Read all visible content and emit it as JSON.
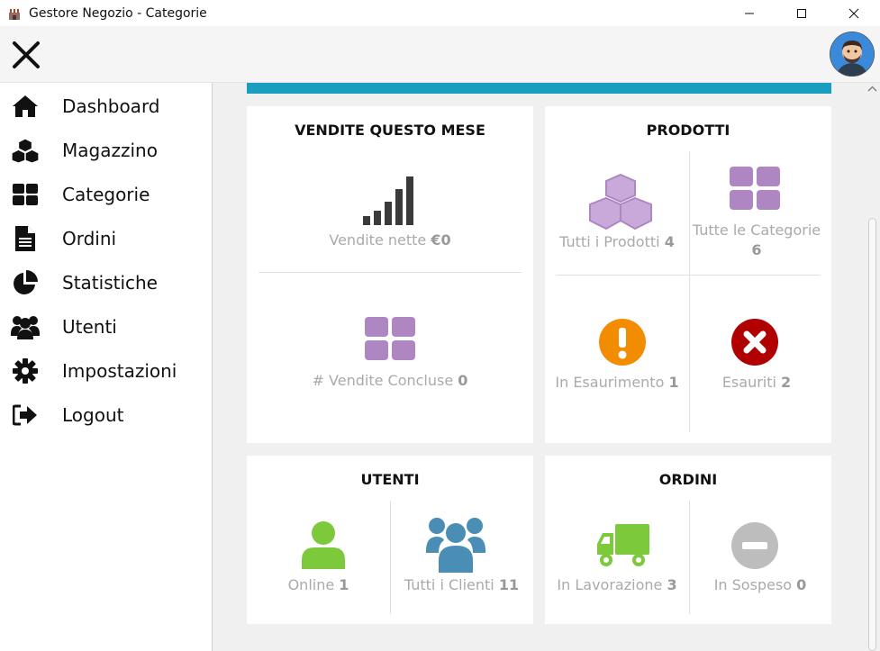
{
  "window": {
    "title": "Gestore Negozio - Categorie"
  },
  "sidebar": {
    "items": [
      {
        "label": "Dashboard",
        "icon": "home-icon"
      },
      {
        "label": "Magazzino",
        "icon": "cubes-icon"
      },
      {
        "label": "Categorie",
        "icon": "grid-icon"
      },
      {
        "label": "Ordini",
        "icon": "document-icon"
      },
      {
        "label": "Statistiche",
        "icon": "pie-chart-icon"
      },
      {
        "label": "Utenti",
        "icon": "users-icon"
      },
      {
        "label": "Impostazioni",
        "icon": "gear-icon"
      },
      {
        "label": "Logout",
        "icon": "logout-icon"
      }
    ]
  },
  "cards": {
    "sales": {
      "title": "VENDITE QUESTO MESE",
      "net_label": "Vendite nette",
      "net_value": "€0",
      "closed_label": "# Vendite Concluse",
      "closed_value": "0"
    },
    "products": {
      "title": "PRODOTTI",
      "all_label": "Tutti i Prodotti",
      "all_value": "4",
      "categories_label": "Tutte le Categorie",
      "categories_value": "6",
      "low_label": "In Esaurimento",
      "low_value": "1",
      "out_label": "Esauriti",
      "out_value": "2"
    },
    "users": {
      "title": "UTENTI",
      "online_label": "Online",
      "online_value": "1",
      "clients_label": "Tutti i Clienti",
      "clients_value": "11"
    },
    "orders": {
      "title": "ORDINI",
      "processing_label": "In Lavorazione",
      "processing_value": "3",
      "pending_label": "In Sospeso",
      "pending_value": "0"
    }
  },
  "colors": {
    "accent": "#1a9ec0",
    "purple": "#ad86c2",
    "orange": "#f28c00",
    "red": "#b00000",
    "green": "#7cca3c",
    "blue": "#4a8db5",
    "gray": "#bdbdbd"
  }
}
